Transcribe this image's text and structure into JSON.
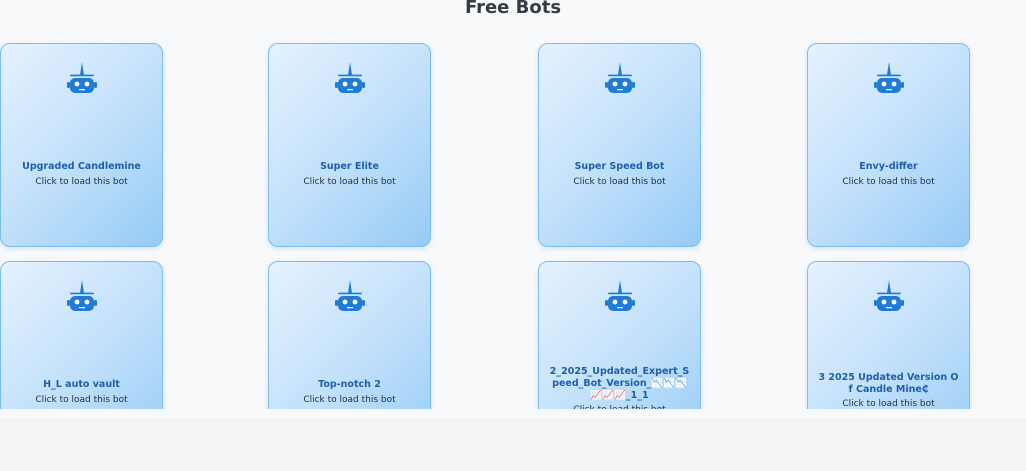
{
  "section_title": "Free Bots",
  "card_subtitle": "Click to load this bot",
  "icon": "robot-icon",
  "colors": {
    "accent": "#1f7bd6",
    "card_border": "#78bdf2",
    "card_title": "#1f5fa8"
  },
  "bots": [
    {
      "name": "Upgraded Candlemine"
    },
    {
      "name": "Super Elite"
    },
    {
      "name": "Super Speed Bot"
    },
    {
      "name": "Envy-differ"
    },
    {
      "name": "H_L auto vault"
    },
    {
      "name": "Top-notch 2"
    },
    {
      "name": "2_2025_Updated_Expert_Speed_Bot_Version_📉📉📉📈📈📈_1_1"
    },
    {
      "name": "3 2025 Updated Version Of Candle Mine₵"
    }
  ]
}
